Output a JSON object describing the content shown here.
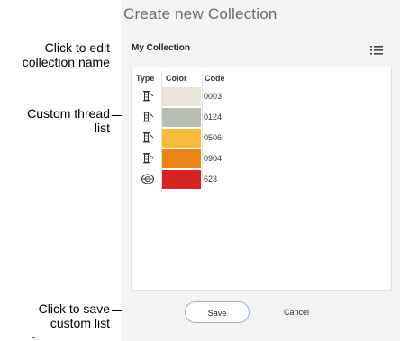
{
  "dialog": {
    "title": "Create new Collection",
    "collection_name": "My Collection",
    "columns": [
      "Type",
      "Color",
      "Code"
    ],
    "rows": [
      {
        "type_icon": "thread-icon",
        "color": "#e8e6dc",
        "code": "0003"
      },
      {
        "type_icon": "thread-icon",
        "color": "#b9beb4",
        "code": "0124"
      },
      {
        "type_icon": "thread-icon",
        "color": "#f7bb3d",
        "code": "0506"
      },
      {
        "type_icon": "thread-icon",
        "color": "#ea8519",
        "code": "0904"
      },
      {
        "type_icon": "spool-icon",
        "color": "#d62321",
        "code": "623"
      }
    ],
    "save_label": "Save",
    "cancel_label": "Cancel"
  },
  "annotations": {
    "edit_name_1": "Click to edit",
    "edit_name_2": "collection name",
    "thread_list_1": "Custom thread",
    "thread_list_2": "list",
    "save_list_1": "Click to save",
    "save_list_2": "custom list"
  }
}
